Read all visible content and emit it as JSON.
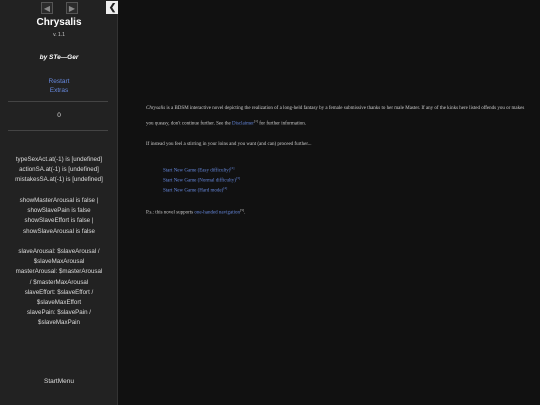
{
  "sidebar": {
    "title": "Chrysalis",
    "version": "v. 1.1",
    "byline": "by STe—Ger",
    "links": [
      "Restart",
      "Extras"
    ],
    "counter": "0",
    "stats1": [
      "typeSexAct.at(-1) is [undefined]",
      "actionSA.at(-1) is [undefined]",
      "mistakesSA.at(-1) is [undefined]"
    ],
    "stats2": [
      "showMasterArousal is false |",
      "showSlavePain is false",
      "showSlaveEffort is false |",
      "showSlaveArousal is false"
    ],
    "stats3": [
      "slaveArousal: $slaveArousal /",
      "$slaveMaxArousal",
      "masterArousal: $masterArousal",
      "/ $masterMaxArousal",
      "slaveEffort: $slaveEffort /",
      "$slaveMaxEffort",
      "slavePain: $slavePain /",
      "$slaveMaxPain"
    ],
    "start_menu": "StartMenu",
    "icons": {
      "back": "chevron-left-icon",
      "forward": "chevron-right-icon",
      "toggle": "chevron-left-icon"
    }
  },
  "main": {
    "intro_title": "Chrysalis",
    "intro_rest": " is a BDSM interactive novel depicting the realization of a long-held fantasy by a female submissive thanks to her male Master. If any of the kinks here listed offends you or makes you queasy, don't continue further. See the ",
    "disclaimer_link": "Disclaimer",
    "disclaimer_sup": "[1]",
    "intro_end": " for further information.",
    "prompt": "If instead you feel a stirring in your loins and you want (and can) proceed further...",
    "games": [
      {
        "label": "Start New Game (Easy difficulty)",
        "sup": "[2]"
      },
      {
        "label": "Start New Game (Normal difficulty)",
        "sup": "[3]"
      },
      {
        "label": "Start New Game (Hard mode)",
        "sup": "[4]"
      }
    ],
    "ps_text": "P.s.: this novel supports ",
    "ps_link": "one-handed navigation",
    "ps_sup": "[5]",
    "ps_end": ".",
    "colors": {
      "link": "#6688dd",
      "background": "#111111",
      "sidebar": "#222222"
    }
  }
}
